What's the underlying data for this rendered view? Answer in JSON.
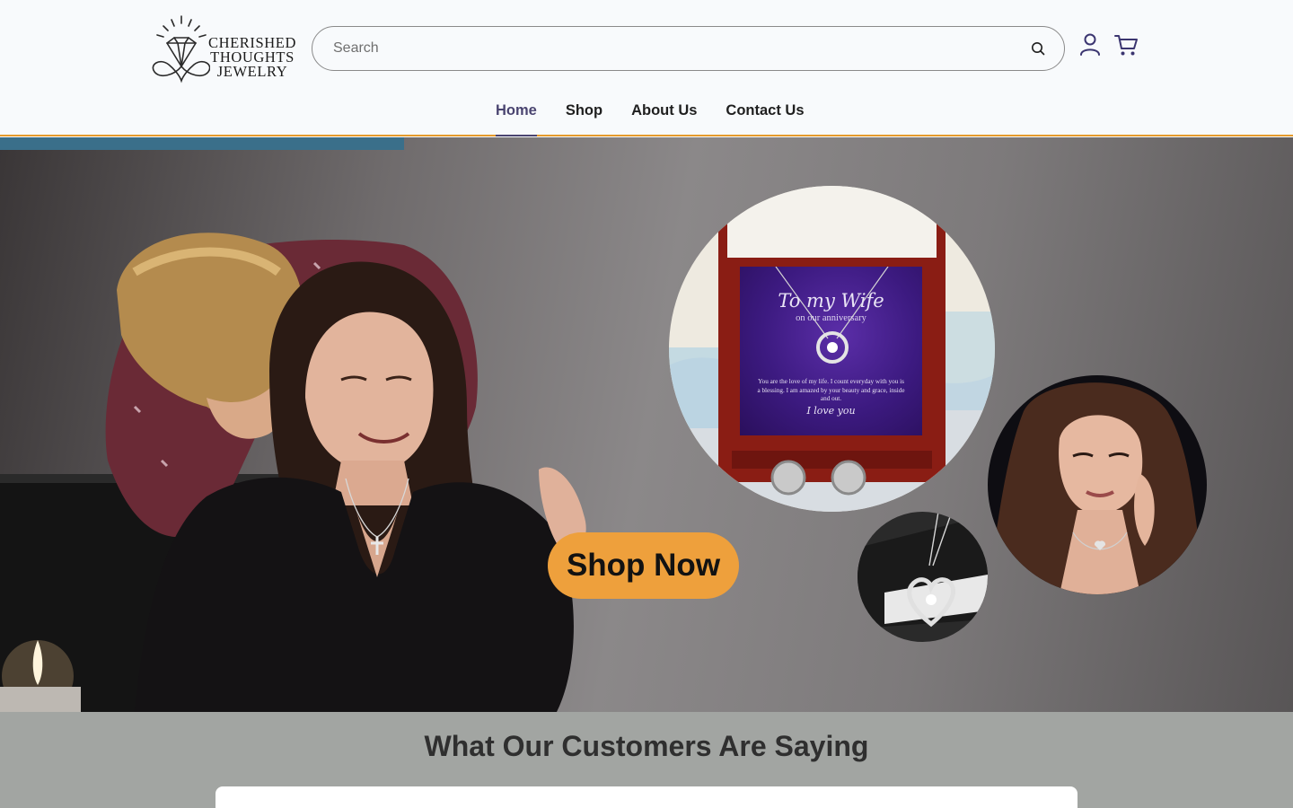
{
  "brand": {
    "name_line1": "CHERISHED",
    "name_line2": "THOUGHTS",
    "name_line3": "JEWELRY"
  },
  "search": {
    "placeholder": "Search",
    "value": "",
    "icon": "search-icon"
  },
  "header_icons": {
    "account": "user-icon",
    "cart": "cart-icon"
  },
  "nav": {
    "items": [
      {
        "label": "Home",
        "active": true
      },
      {
        "label": "Shop",
        "active": false
      },
      {
        "label": "About Us",
        "active": false
      },
      {
        "label": "Contact Us",
        "active": false
      }
    ]
  },
  "hero": {
    "card_title": "To my Wife",
    "card_subtitle": "on our anniversary",
    "card_message": "You are the love of my life. I count everyday with you is a blessing. I am amazed by your beauty and grace, inside and out.",
    "card_signoff": "I love you",
    "cta_label": "Shop Now"
  },
  "testimonials": {
    "heading": "What Our Customers Are Saying"
  },
  "colors": {
    "accent": "#eea03c",
    "header_border": "#e59a2c",
    "nav_active": "#4a4470",
    "testimonials_bg": "#a2a5a2"
  }
}
